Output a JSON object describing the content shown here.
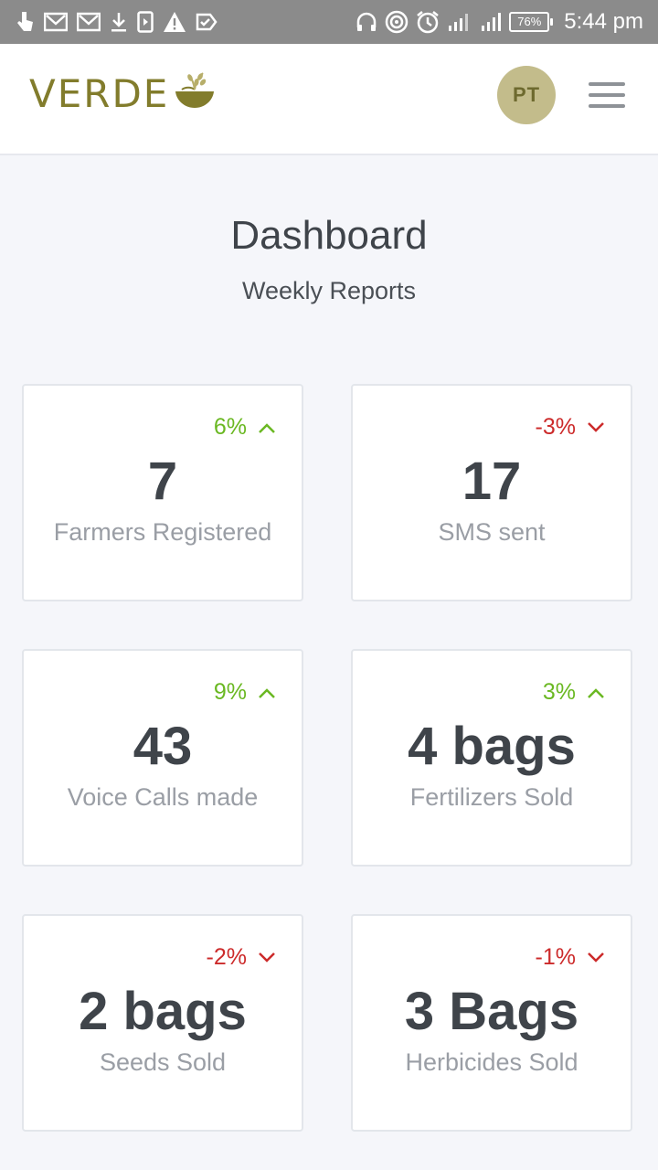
{
  "status_bar": {
    "battery": "76%",
    "time": "5:44 pm",
    "left_icons": [
      "touch-icon",
      "gmail-icon",
      "gmail-icon",
      "download-icon",
      "media-icon",
      "warning-icon",
      "check-icon"
    ],
    "right_icons": [
      "headphones-icon",
      "hotspot-icon",
      "alarm-icon",
      "signal-icon",
      "signal-icon"
    ]
  },
  "header": {
    "brand": "VERDE",
    "avatar_initials": "PT",
    "colors": {
      "brand": "#827c2c",
      "avatar_bg": "#c3bc8b"
    }
  },
  "page": {
    "title": "Dashboard",
    "subtitle": "Weekly Reports"
  },
  "cards": [
    {
      "value": "7",
      "label": "Farmers Registered",
      "change": "6%",
      "trend": "up"
    },
    {
      "value": "17",
      "label": "SMS sent",
      "change": "-3%",
      "trend": "down"
    },
    {
      "value": "43",
      "label": "Voice Calls made",
      "change": "9%",
      "trend": "up"
    },
    {
      "value": "4 bags",
      "label": "Fertilizers Sold",
      "change": "3%",
      "trend": "up"
    },
    {
      "value": "2 bags",
      "label": "Seeds Sold",
      "change": "-2%",
      "trend": "down"
    },
    {
      "value": "3 Bags",
      "label": "Herbicides Sold",
      "change": "-1%",
      "trend": "down"
    }
  ],
  "colors": {
    "up": "#6ab822",
    "down": "#cc2a2a"
  }
}
